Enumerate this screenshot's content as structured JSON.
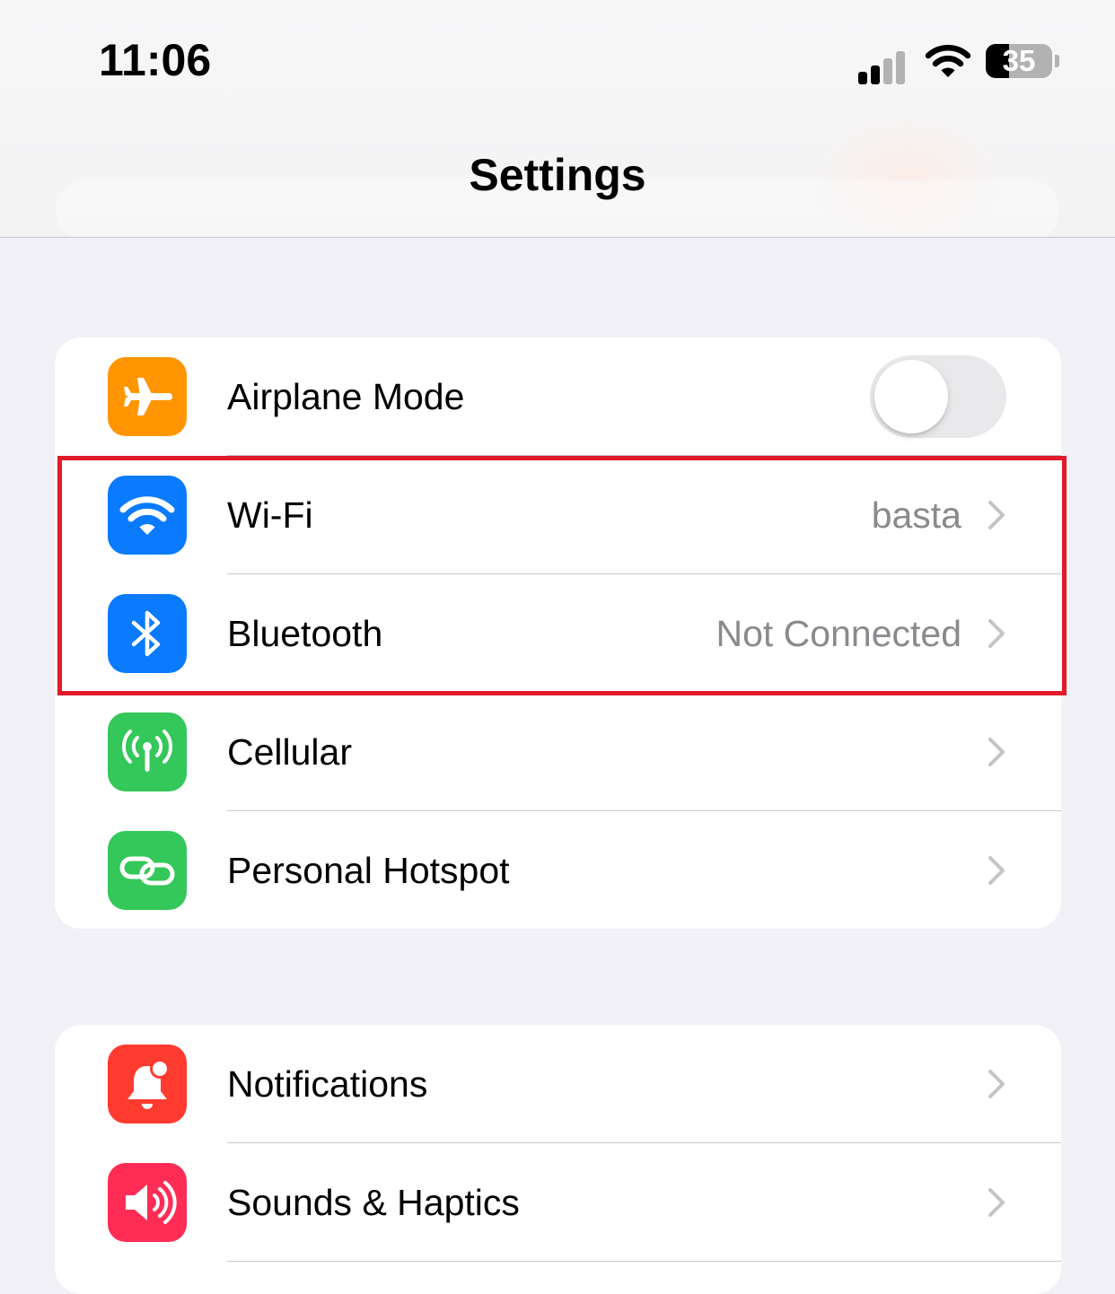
{
  "status_bar": {
    "time": "11:06",
    "battery_percent": "35",
    "battery_level": 0.35,
    "signal_bars_active": 2,
    "signal_bars_total": 4
  },
  "nav": {
    "title": "Settings"
  },
  "colors": {
    "airplane": "#ff9500",
    "wifi": "#0a7aff",
    "bluetooth": "#0a7aff",
    "cellular": "#34c759",
    "hotspot": "#34c759",
    "notifications": "#ff3b30",
    "sounds": "#ff2d55",
    "highlight": "#e01b2a"
  },
  "groups": [
    {
      "rows": [
        {
          "label": "Airplane Mode",
          "icon": "airplane-icon",
          "control": "toggle",
          "toggle_on": false
        },
        {
          "label": "Wi-Fi",
          "icon": "wifi-icon",
          "value": "basta"
        },
        {
          "label": "Bluetooth",
          "icon": "bluetooth-icon",
          "value": "Not Connected"
        },
        {
          "label": "Cellular",
          "icon": "antenna-icon"
        },
        {
          "label": "Personal Hotspot",
          "icon": "link-icon"
        }
      ]
    },
    {
      "rows": [
        {
          "label": "Notifications",
          "icon": "bell-icon"
        },
        {
          "label": "Sounds & Haptics",
          "icon": "speaker-icon"
        }
      ]
    }
  ]
}
